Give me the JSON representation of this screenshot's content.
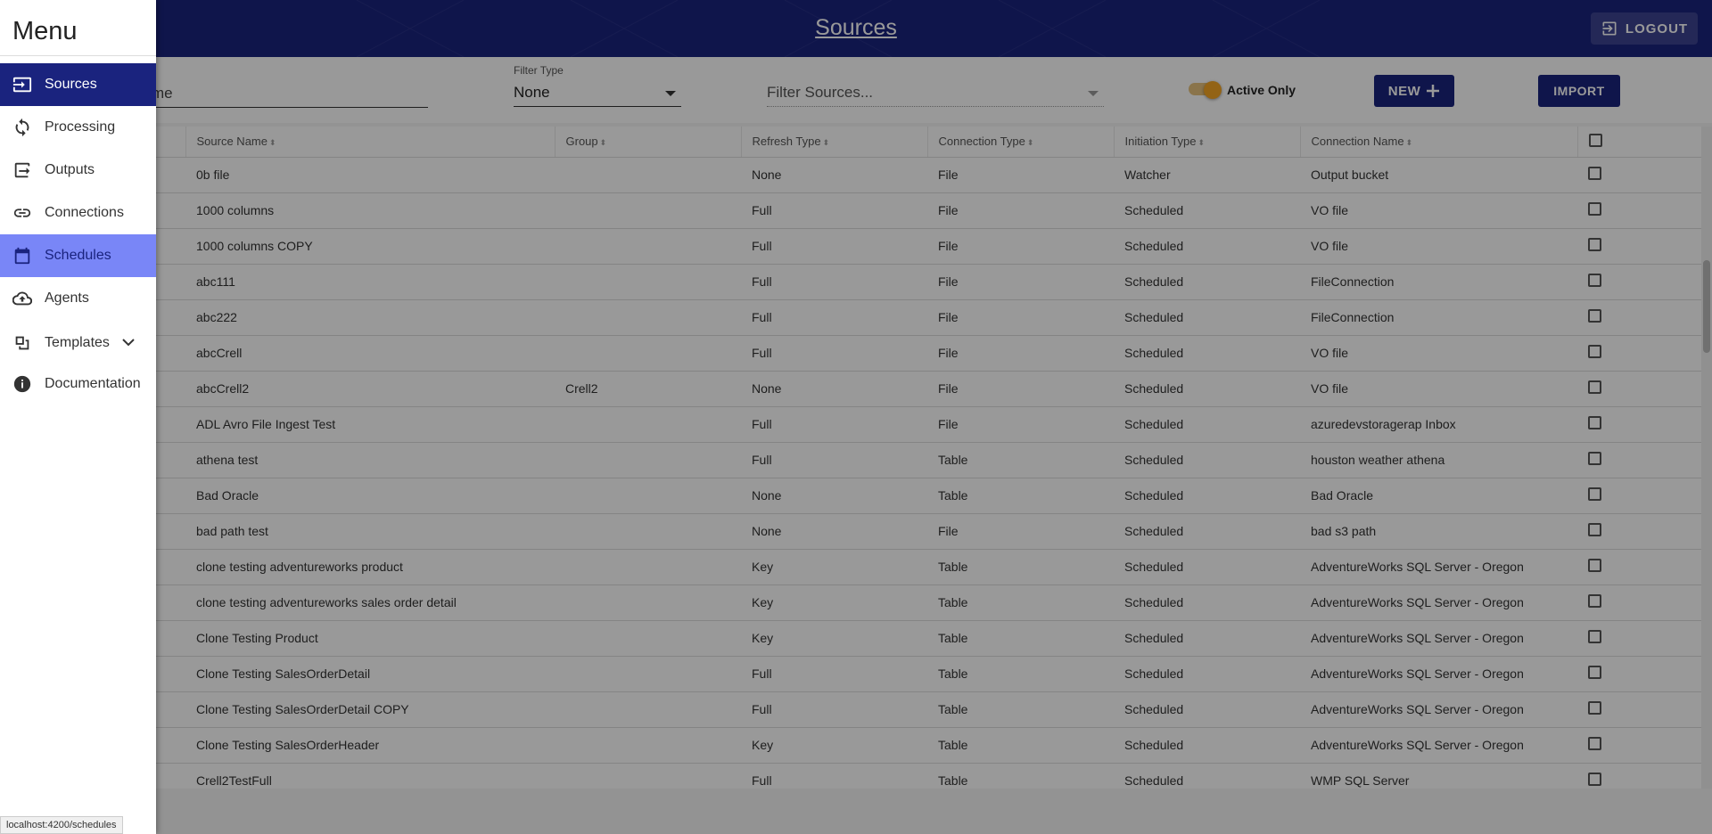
{
  "header": {
    "title": "Sources",
    "logout_label": "LOGOUT"
  },
  "filters": {
    "name_partial": "me",
    "type_label": "Filter Type",
    "type_value": "None",
    "sources_placeholder": "Filter Sources...",
    "active_only_label": "Active Only",
    "active_only": true,
    "new_label": "NEW",
    "import_label": "IMPORT"
  },
  "table": {
    "headers": [
      "Source Name",
      "Group",
      "Refresh Type",
      "Connection Type",
      "Initiation Type",
      "Connection Name"
    ],
    "rows": [
      [
        "0b file",
        "",
        "None",
        "File",
        "Watcher",
        "Output bucket"
      ],
      [
        "1000 columns",
        "",
        "Full",
        "File",
        "Scheduled",
        "VO file"
      ],
      [
        "1000 columns COPY",
        "",
        "Full",
        "File",
        "Scheduled",
        "VO file"
      ],
      [
        "abc111",
        "",
        "Full",
        "File",
        "Scheduled",
        "FileConnection"
      ],
      [
        "abc222",
        "",
        "Full",
        "File",
        "Scheduled",
        "FileConnection"
      ],
      [
        "abcCrell",
        "",
        "Full",
        "File",
        "Scheduled",
        "VO file"
      ],
      [
        "abcCrell2",
        "Crell2",
        "None",
        "File",
        "Scheduled",
        "VO file"
      ],
      [
        "ADL Avro File Ingest Test",
        "",
        "Full",
        "File",
        "Scheduled",
        "azuredevstoragerap Inbox"
      ],
      [
        "athena test",
        "",
        "Full",
        "Table",
        "Scheduled",
        "houston weather athena"
      ],
      [
        "Bad Oracle",
        "",
        "None",
        "Table",
        "Scheduled",
        "Bad Oracle"
      ],
      [
        "bad path test",
        "",
        "None",
        "File",
        "Scheduled",
        "bad s3 path"
      ],
      [
        "clone testing adventureworks product",
        "",
        "Key",
        "Table",
        "Scheduled",
        "AdventureWorks SQL Server - Oregon"
      ],
      [
        "clone testing adventureworks sales order detail",
        "",
        "Key",
        "Table",
        "Scheduled",
        "AdventureWorks SQL Server - Oregon"
      ],
      [
        "Clone Testing Product",
        "",
        "Key",
        "Table",
        "Scheduled",
        "AdventureWorks SQL Server - Oregon"
      ],
      [
        "Clone Testing SalesOrderDetail",
        "",
        "Full",
        "Table",
        "Scheduled",
        "AdventureWorks SQL Server - Oregon"
      ],
      [
        "Clone Testing SalesOrderDetail COPY",
        "",
        "Full",
        "Table",
        "Scheduled",
        "AdventureWorks SQL Server - Oregon"
      ],
      [
        "Clone Testing SalesOrderHeader",
        "",
        "Key",
        "Table",
        "Scheduled",
        "AdventureWorks SQL Server - Oregon"
      ],
      [
        "Crell2TestFull",
        "",
        "Full",
        "Table",
        "Scheduled",
        "WMP SQL Server"
      ]
    ]
  },
  "menu": {
    "title": "Menu",
    "items": [
      {
        "label": "Sources",
        "icon": "input-icon"
      },
      {
        "label": "Processing",
        "icon": "sync-icon"
      },
      {
        "label": "Outputs",
        "icon": "output-icon"
      },
      {
        "label": "Connections",
        "icon": "link-icon"
      },
      {
        "label": "Schedules",
        "icon": "calendar-icon"
      },
      {
        "label": "Agents",
        "icon": "cloud-upload-icon"
      },
      {
        "label": "Templates",
        "icon": "template-icon"
      },
      {
        "label": "Documentation",
        "icon": "info-icon"
      }
    ]
  },
  "status_url": "localhost:4200/schedules",
  "colors": {
    "primary": "#1a237e",
    "hover": "#7986f7",
    "accent": "#f5a623"
  }
}
